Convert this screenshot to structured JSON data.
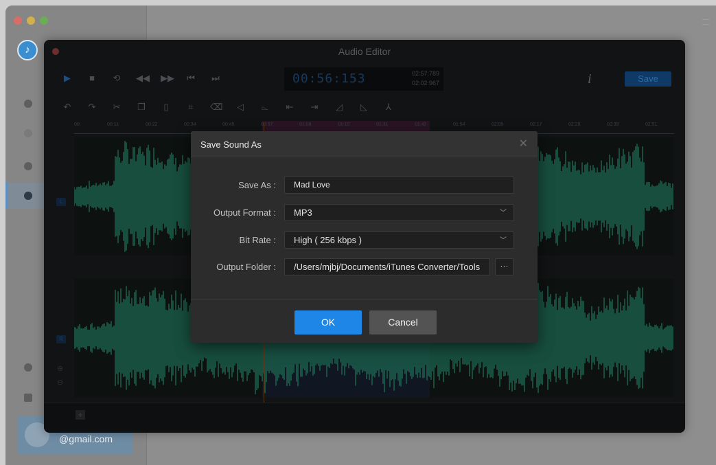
{
  "colors": {
    "accent": "#1e86e6",
    "waveform": "#1d6b54",
    "dialog_bg": "#2c2c2c",
    "editor_bg": "#121314"
  },
  "app": {
    "sidebar": {
      "logo_icon": "music-note-icon",
      "items": [
        {
          "icon": "home-icon"
        },
        {
          "icon": "music-icon"
        },
        {
          "icon": "history-icon"
        },
        {
          "icon": "toolbox-icon",
          "active": true
        },
        {
          "icon": "gear-icon"
        },
        {
          "icon": "mail-icon"
        }
      ],
      "user": {
        "email": "@gmail.com"
      }
    }
  },
  "editor": {
    "title": "Audio Editor",
    "time": {
      "current": "00:56:153",
      "total": "02:57:789",
      "selection": "02:02:967"
    },
    "save_label": "Save",
    "ruler_ticks": [
      "00:",
      "00:11",
      "00:22",
      "00:34",
      "00:45",
      "00:57",
      "01:08",
      "01:19",
      "01:31",
      "01:42",
      "01:54",
      "02:05",
      "02:17",
      "02:28",
      "02:39",
      "02:51"
    ]
  },
  "dialog": {
    "title": "Save Sound As",
    "save_as": {
      "label": "Save As :",
      "value": "Mad Love"
    },
    "output_format": {
      "label": "Output Format :",
      "value": "MP3"
    },
    "bit_rate": {
      "label": "Bit Rate :",
      "value": "High ( 256 kbps )"
    },
    "output_folder": {
      "label": "Output Folder :",
      "value": "/Users/mjbj/Documents/iTunes Converter/Tools"
    },
    "browse_label": "···",
    "ok_label": "OK",
    "cancel_label": "Cancel"
  }
}
